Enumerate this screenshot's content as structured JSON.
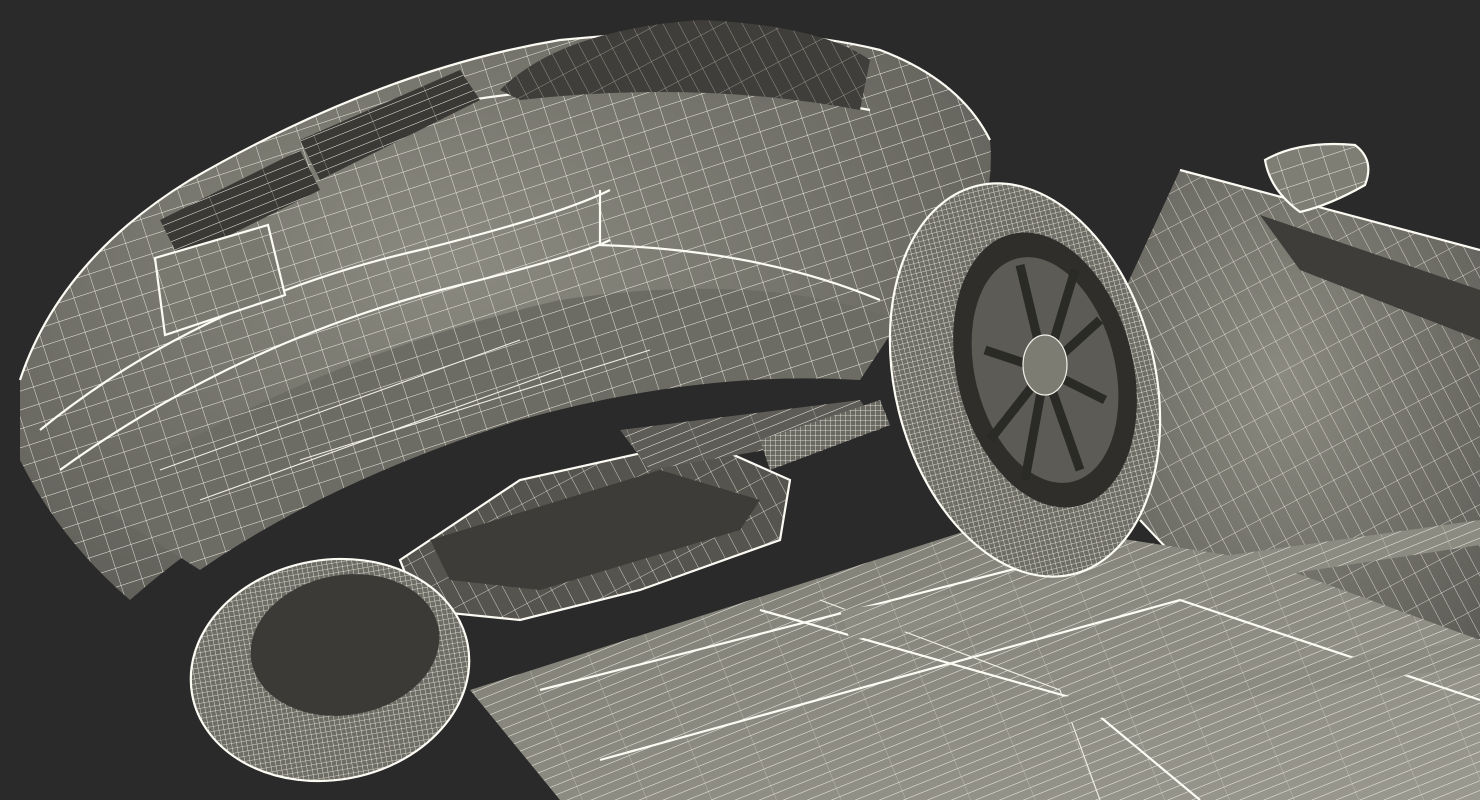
{
  "scene": {
    "subject": "car-underside-wireframe-render",
    "colors": {
      "background": "#2a2a2a",
      "surface": "#6f6e66",
      "surface_light": "#8a897f",
      "surface_dark": "#4a4944",
      "wire": "#f1efe6"
    }
  }
}
